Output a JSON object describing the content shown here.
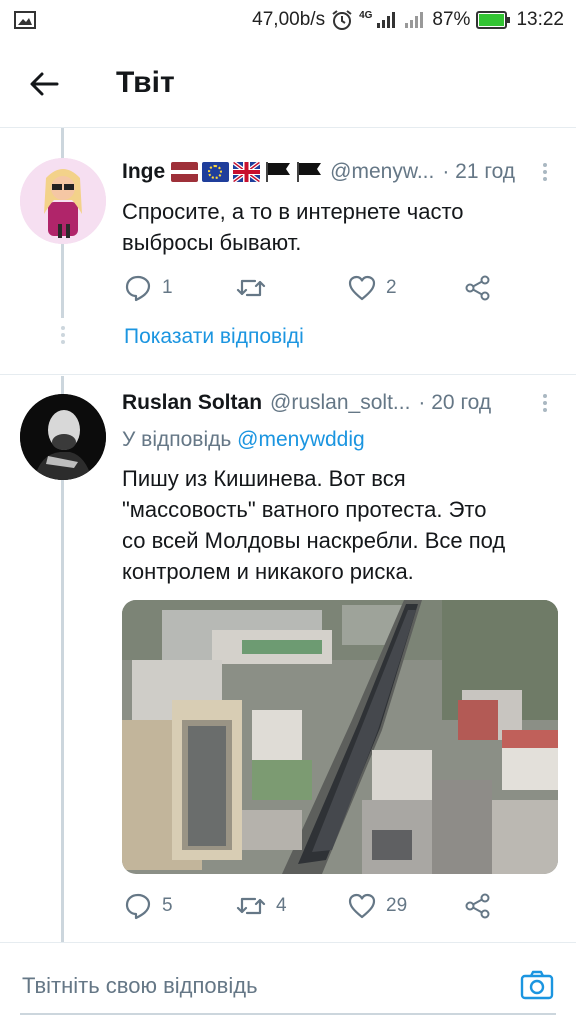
{
  "status_bar": {
    "speed": "47,00b/s",
    "network": "4G",
    "battery": "87%",
    "time": "13:22",
    "icons": [
      "image-icon",
      "alarm-icon",
      "signal-icon",
      "battery-icon"
    ]
  },
  "header": {
    "title": "Твіт"
  },
  "tweet1": {
    "name": "Inge",
    "flags": [
      "latvia-flag",
      "eu-flag",
      "uk-flag",
      "black-flag",
      "black-flag"
    ],
    "handle": "@menyw...",
    "time": "· 21 год",
    "text_lines": [
      "Спросите, а то в интернете часто",
      "выбросы бывают."
    ],
    "replies": "1",
    "retweets": "",
    "likes": "2"
  },
  "show_replies": "Показати відповіді",
  "tweet2": {
    "name": "Ruslan Soltan",
    "handle": "@ruslan_solt...",
    "time": "· 20 год",
    "reply_prefix": "У відповідь",
    "reply_mention": "@menywddig",
    "text_lines": [
      "Пишу из Кишинева. Вот вся",
      "\"массовость\" ватного протеста. Это",
      "со всей Молдовы наскребли. Все под",
      "контролем и никакого риска."
    ],
    "replies": "5",
    "retweets": "4",
    "likes": "29"
  },
  "composer": {
    "placeholder": "Твітніть свою відповідь"
  },
  "colors": {
    "accent": "#1b95e0",
    "secondary_text": "#657786",
    "divider": "#e6ecf0"
  }
}
